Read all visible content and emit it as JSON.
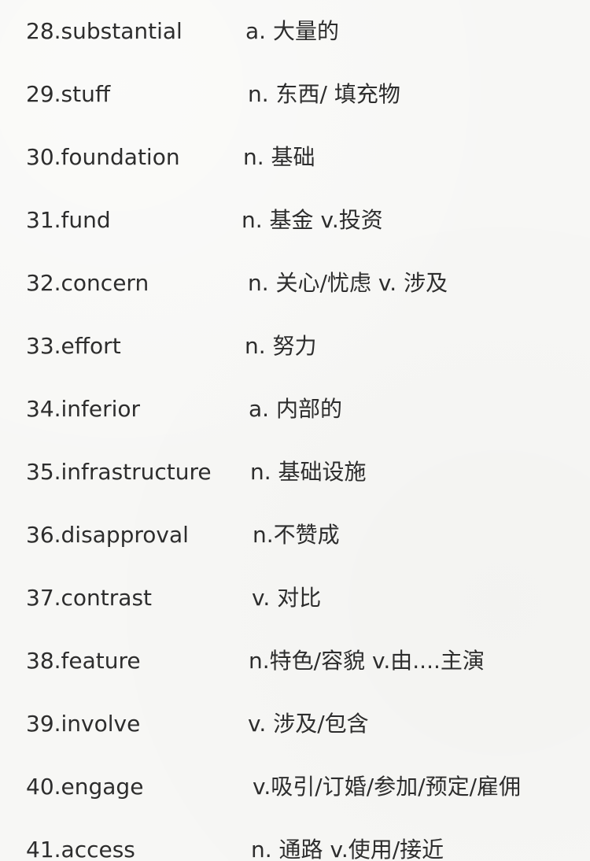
{
  "entries": [
    {
      "term": "28.substantial",
      "meaning": "a. 大量的"
    },
    {
      "term": "29.stuff",
      "meaning": "n. 东西/ 填充物"
    },
    {
      "term": "30.foundation",
      "meaning": "n. 基础"
    },
    {
      "term": "31.fund",
      "meaning": "n. 基金  v.投资"
    },
    {
      "term": "32.concern",
      "meaning": "n. 关心/忧虑    v. 涉及"
    },
    {
      "term": "33.effort",
      "meaning": "n. 努力"
    },
    {
      "term": "34.inferior",
      "meaning": "a. 内部的"
    },
    {
      "term": "35.infrastructure",
      "meaning": "n. 基础设施"
    },
    {
      "term": "36.disapproval",
      "meaning": "n.不赞成"
    },
    {
      "term": "37.contrast",
      "meaning": "v. 对比"
    },
    {
      "term": "38.feature",
      "meaning": "n.特色/容貌   v.由....主演"
    },
    {
      "term": "39.involve",
      "meaning": "v. 涉及/包含"
    },
    {
      "term": "40.engage",
      "meaning": "v.吸引/订婚/参加/预定/雇佣"
    },
    {
      "term": "41.access",
      "meaning": "n. 通路   v.使用/接近"
    }
  ]
}
